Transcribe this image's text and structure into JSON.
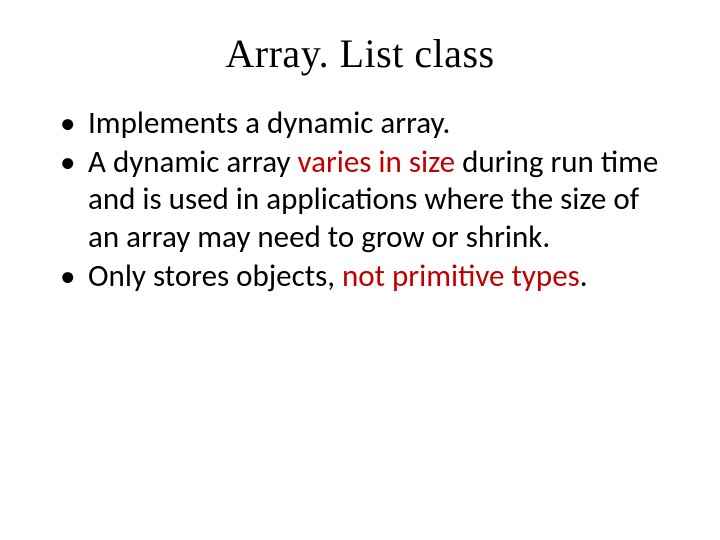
{
  "slide": {
    "title": "Array. List class",
    "bullets": {
      "b1": "Implements a dynamic array.",
      "b2_a": "A dynamic array ",
      "b2_red": "varies in size ",
      "b2_b": "during run time and is used in applications where the size of an array may need to grow or shrink.",
      "b3_a": "Only stores objects, ",
      "b3_red": "not primitive types",
      "b3_b": "."
    }
  }
}
